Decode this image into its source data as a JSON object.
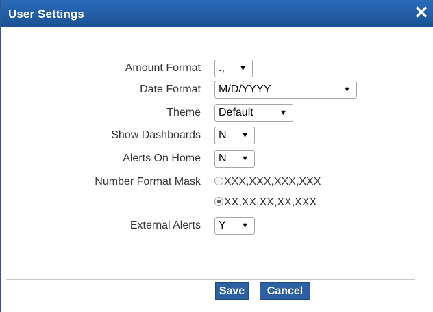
{
  "dialog": {
    "title": "User Settings",
    "close_glyph": "✕"
  },
  "settings": {
    "amount_format": {
      "label": "Amount Format",
      "value": ".,"
    },
    "date_format": {
      "label": "Date Format",
      "value": "M/D/YYYY"
    },
    "theme": {
      "label": "Theme",
      "value": "Default"
    },
    "show_dashboards": {
      "label": "Show Dashboards",
      "value": "N"
    },
    "alerts_on_home": {
      "label": "Alerts On Home",
      "value": "N"
    },
    "number_format_mask": {
      "label": "Number Format Mask",
      "options": [
        {
          "text": "XXX,XXX,XXX,XXX",
          "checked": false
        },
        {
          "text": "XX,XX,XX,XX,XXX",
          "checked": true
        }
      ]
    },
    "external_alerts": {
      "label": "External Alerts",
      "value": "Y"
    }
  },
  "footer": {
    "save_label": "Save",
    "cancel_label": "Cancel"
  },
  "icons": {
    "dropdown_arrow": "▼"
  },
  "colors": {
    "titlebar": "#1f5aa0",
    "button": "#2d5fa3"
  }
}
